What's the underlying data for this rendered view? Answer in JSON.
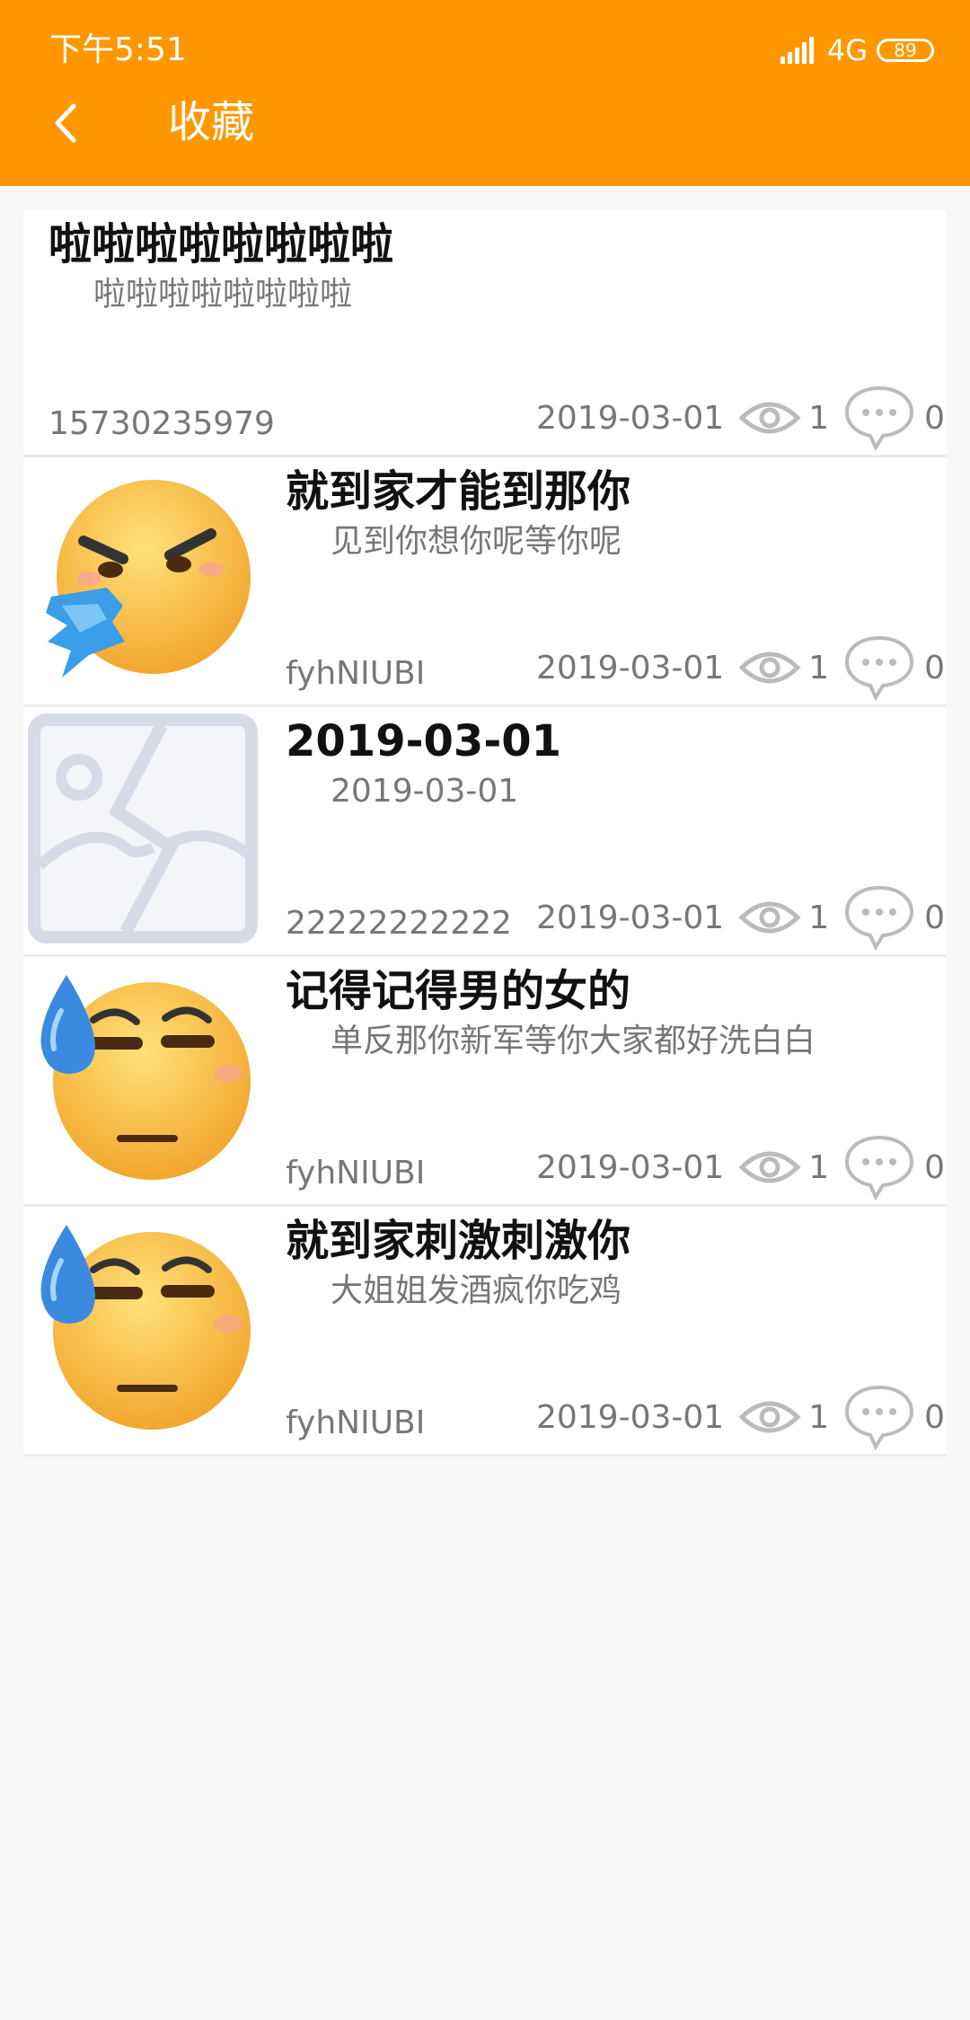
{
  "status_bar": {
    "time": "下午5:51",
    "network": "4G",
    "battery": "89"
  },
  "header": {
    "title": "收藏"
  },
  "favorites": [
    {
      "title": "啦啦啦啦啦啦啦啦",
      "subtitle": "啦啦啦啦啦啦啦啦",
      "author": "15730235979",
      "date": "2019-03-01",
      "views": "1",
      "comments": "0",
      "image": "none"
    },
    {
      "title": "就到家才能到那你",
      "subtitle": "见到你想你呢等你呢",
      "author": "fyhNIUBI",
      "date": "2019-03-01",
      "views": "1",
      "comments": "0",
      "image": "angry-emoji"
    },
    {
      "title": "2019-03-01",
      "subtitle": "2019-03-01",
      "author": "22222222222",
      "date": "2019-03-01",
      "views": "1",
      "comments": "0",
      "image": "image-placeholder"
    },
    {
      "title": "记得记得男的女的",
      "subtitle": "单反那你新军等你大家都好洗白白",
      "author": "fyhNIUBI",
      "date": "2019-03-01",
      "views": "1",
      "comments": "0",
      "image": "sweat-emoji"
    },
    {
      "title": "就到家刺激刺激你",
      "subtitle": "大姐姐发酒疯你吃鸡",
      "author": "fyhNIUBI",
      "date": "2019-03-01",
      "views": "1",
      "comments": "0",
      "image": "sweat-emoji"
    }
  ],
  "colors": {
    "header": "#ff9800",
    "background": "#f8f8f8",
    "text_primary": "#111111",
    "text_secondary": "#777777"
  }
}
